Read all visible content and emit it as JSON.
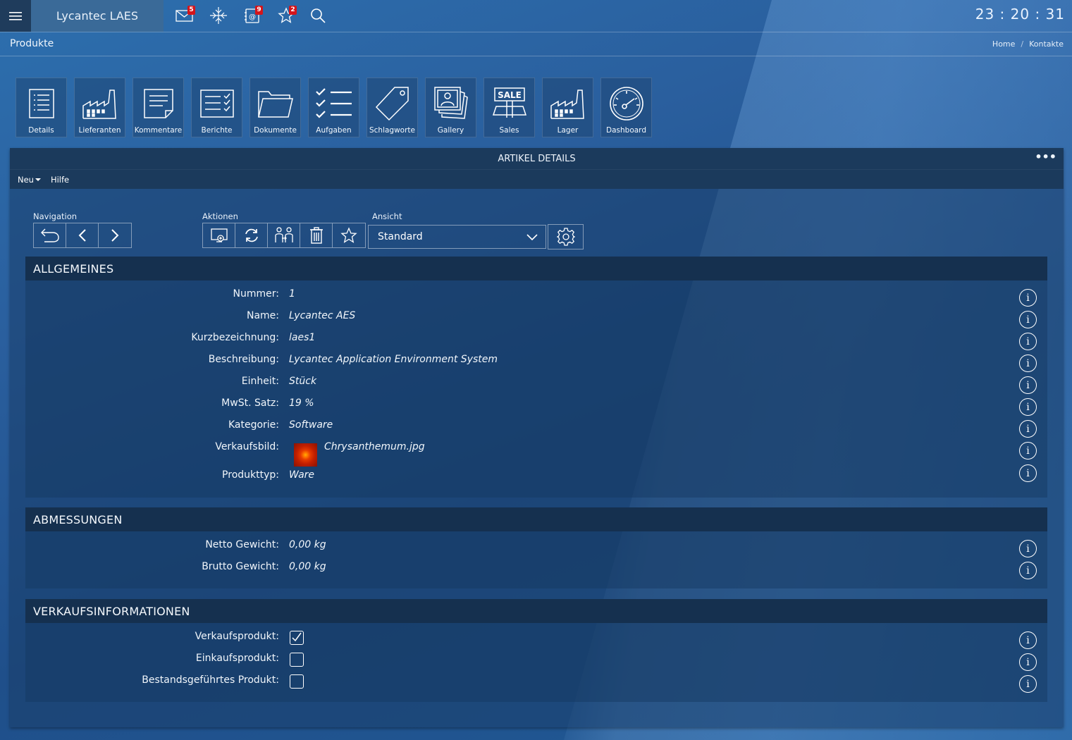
{
  "app": {
    "title": "Lycantec LAES",
    "clock": "23 : 20 : 31"
  },
  "topbar": {
    "icons": [
      {
        "name": "mail-icon",
        "badge": "5"
      },
      {
        "name": "compress-icon",
        "badge": ""
      },
      {
        "name": "contacts-icon",
        "badge": "9"
      },
      {
        "name": "favorites-icon",
        "badge": "2"
      },
      {
        "name": "search-icon",
        "badge": ""
      }
    ]
  },
  "breadcrumb": {
    "page_title": "Produkte",
    "items": [
      "Home",
      "Kontakte"
    ],
    "separator": "/"
  },
  "tiles": [
    {
      "label": "Details",
      "icon": "list-icon"
    },
    {
      "label": "Lieferanten",
      "icon": "factory-icon"
    },
    {
      "label": "Kommentare",
      "icon": "comment-doc-icon"
    },
    {
      "label": "Berichte",
      "icon": "report-icon"
    },
    {
      "label": "Dokumente",
      "icon": "folder-icon"
    },
    {
      "label": "Aufgaben",
      "icon": "checklist-icon"
    },
    {
      "label": "Schlagworte",
      "icon": "tag-icon"
    },
    {
      "label": "Gallery",
      "icon": "photos-icon"
    },
    {
      "label": "Sales",
      "icon": "sale-sign-icon"
    },
    {
      "label": "Lager",
      "icon": "warehouse-icon"
    },
    {
      "label": "Dashboard",
      "icon": "gauge-icon"
    }
  ],
  "panel": {
    "title": "ARTIKEL DETAILS",
    "more": "•••",
    "menu": {
      "new": "Neu",
      "help": "Hilfe"
    },
    "toolbar": {
      "navigation_label": "Navigation",
      "actions_label": "Aktionen",
      "view_label": "Ansicht",
      "view_value": "Standard"
    }
  },
  "sections": {
    "general": {
      "title": "ALLGEMEINES",
      "fields": [
        {
          "label": "Nummer:",
          "value": "1"
        },
        {
          "label": "Name:",
          "value": "Lycantec AES"
        },
        {
          "label": "Kurzbezeichnung:",
          "value": "laes1"
        },
        {
          "label": "Beschreibung:",
          "value": "Lycantec Application Environment System"
        },
        {
          "label": "Einheit:",
          "value": "Stück"
        },
        {
          "label": "MwSt. Satz:",
          "value": "19 %"
        },
        {
          "label": "Kategorie:",
          "value": "Software"
        },
        {
          "label": "Verkaufsbild:",
          "value": "Chrysanthemum.jpg"
        },
        {
          "label": "Produkttyp:",
          "value": "Ware"
        }
      ]
    },
    "dimensions": {
      "title": "ABMESSUNGEN",
      "fields": [
        {
          "label": "Netto Gewicht:",
          "value": "0,00 kg"
        },
        {
          "label": "Brutto Gewicht:",
          "value": "0,00 kg"
        }
      ]
    },
    "sales": {
      "title": "VERKAUFSINFORMATIONEN",
      "fields": [
        {
          "label": "Verkaufsprodukt:",
          "checked": true
        },
        {
          "label": "Einkaufsprodukt:",
          "checked": false
        },
        {
          "label": "Bestandsgeführtes Produkt:",
          "checked": false
        }
      ]
    }
  },
  "info_glyph": "i"
}
